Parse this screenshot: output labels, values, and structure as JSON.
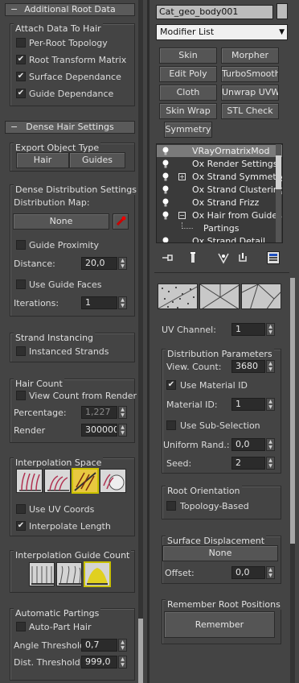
{
  "left": {
    "root_data": {
      "header": "Additional Root Data",
      "attach_group": "Attach Data To Hair",
      "options": [
        {
          "label": "Per-Root Topology",
          "checked": false
        },
        {
          "label": "Root Transform Matrix",
          "checked": true
        },
        {
          "label": "Surface Dependance",
          "checked": true
        },
        {
          "label": "Guide Dependance",
          "checked": true
        }
      ]
    },
    "dense": {
      "header": "Dense Hair Settings",
      "export_group": "Export Object Type",
      "export_buttons": [
        "Hair",
        "Guides"
      ],
      "distribution_group": "Dense Distribution Settings",
      "distribution_map_label": "Distribution Map:",
      "distribution_map_value": "None",
      "guide_proximity": {
        "label": "Guide Proximity",
        "checked": false
      },
      "distance_label": "Distance:",
      "distance_value": "20,0",
      "use_guide_faces": {
        "label": "Use Guide Faces",
        "checked": false
      },
      "iterations_label": "Iterations:",
      "iterations_value": "1",
      "strand_instancing_group": "Strand Instancing",
      "instanced_strands": {
        "label": "Instanced Strands",
        "checked": false
      },
      "hair_count_group": "Hair Count",
      "view_count_from_render": {
        "label": "View Count from Render",
        "checked": false
      },
      "percentage_label": "Percentage:",
      "percentage_value": "1,227",
      "render_label": "Render",
      "render_value": "300000",
      "interp_space_group": "Interpolation Space",
      "use_uv_coords": {
        "label": "Use UV Coords",
        "checked": false
      },
      "interpolate_length": {
        "label": "Interpolate Length",
        "checked": true
      },
      "interp_guide_count_group": "Interpolation Guide Count",
      "auto_partings_group": "Automatic Partings",
      "auto_part_hair": {
        "label": "Auto-Part Hair",
        "checked": false
      },
      "angle_threshold_label": "Angle Threshold:",
      "angle_threshold_value": "0,7",
      "dist_threshold_label": "Dist. Threshold:",
      "dist_threshold_value": "999,0"
    }
  },
  "right": {
    "object_name": "Cat_geo_body001",
    "object_color": "#bcbcbc",
    "modifier_list_label": "Modifier List",
    "modifier_buttons": [
      "Skin",
      "Morpher",
      "Edit Poly",
      "TurboSmooth",
      "Cloth",
      "Unwrap UVW",
      "Skin Wrap",
      "STL Check",
      "Symmetry"
    ],
    "stack": [
      {
        "label": "VRayOrnatrixMod",
        "highlight": true
      },
      {
        "label": "Ox Render Settings",
        "highlight": false
      },
      {
        "label": "Ox Strand Symmetry",
        "highlight": false,
        "expander": "+"
      },
      {
        "label": "Ox Strand Clustering",
        "highlight": false
      },
      {
        "label": "Ox Strand Frizz",
        "highlight": false
      },
      {
        "label": "Ox Hair from Guides",
        "highlight": false,
        "expander": "-"
      },
      {
        "label": "Partings",
        "highlight": false,
        "child": true
      },
      {
        "label": "Ox Strand Detail",
        "highlight": false
      }
    ],
    "uv_channel_label": "UV Channel:",
    "uv_channel_value": "1",
    "distribution_params_group": "Distribution Parameters",
    "view_count_label": "View. Count:",
    "view_count_value": "3680",
    "use_material_id": {
      "label": "Use Material ID",
      "checked": true
    },
    "material_id_label": "Material ID:",
    "material_id_value": "1",
    "use_sub_selection": {
      "label": "Use Sub-Selection",
      "checked": false
    },
    "uniform_rand_label": "Uniform Rand.:",
    "uniform_rand_value": "0,0",
    "seed_label": "Seed:",
    "seed_value": "2",
    "root_orientation_group": "Root Orientation",
    "topology_based": {
      "label": "Topology-Based",
      "checked": false
    },
    "surface_displacement_group": "Surface Displacement",
    "surface_displacement_map": "None",
    "offset_label": "Offset:",
    "offset_value": "0,0",
    "remember_root_group": "Remember Root Positions",
    "remember_button": "Remember"
  },
  "icons": [
    "light-bulb-icon",
    "pin-stack-icon",
    "show-end-result-icon",
    "make-unique-icon",
    "remove-modifier-icon",
    "configure-sets-icon",
    "color-swatch-icon",
    "dropdown-arrow-icon",
    "map-picker-icon"
  ]
}
